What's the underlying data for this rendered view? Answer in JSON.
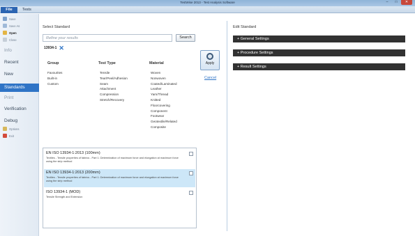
{
  "window": {
    "title": "TestWise 2013 - Test Analysis Software",
    "controls": [
      "–",
      "□",
      "✕"
    ]
  },
  "menu": {
    "file": "File",
    "tests": "Tests"
  },
  "sidebar": {
    "save": "Save",
    "save_as": "Save As",
    "open": "Open",
    "close": "Close",
    "info": "Info",
    "recent": "Recent",
    "new": "New",
    "standards": "Standards",
    "print": "Print",
    "verification": "Verification",
    "debug": "Debug",
    "options": "Options",
    "exit": "Exit"
  },
  "select_standard": {
    "title": "Select Standard",
    "search_placeholder": "Refine your results",
    "search_button": "Search",
    "filter_token": "13934-1",
    "columns": [
      {
        "header": "Group",
        "items": [
          "Favourites",
          "Built-in",
          "Custom"
        ]
      },
      {
        "header": "Test Type",
        "items": [
          "Tensile",
          "Tear/Peel/Adhesion",
          "Seam",
          "Attachment",
          "Compression",
          "Stretch/Recovery"
        ]
      },
      {
        "header": "Material",
        "items": [
          "Woven",
          "Nonwoven",
          "Coated/Laminated",
          "Leather",
          "Yarn/Thread",
          "Knitted",
          "Floorcovering",
          "Component",
          "Footwear",
          "Geotextile/Related",
          "Composite"
        ]
      }
    ],
    "apply_label": "Apply",
    "cancel_label": "Cancel",
    "results": [
      {
        "title": "EN ISO 13934-1:2013 (100mm)",
        "desc": "Textiles - Tensile properties of fabrics - Part 1: Determination of maximum force and elongation at maximum force using the strip method",
        "selected": false
      },
      {
        "title": "EN ISO 13934-1:2013 (200mm)",
        "desc": "Textiles - Tensile properties of fabrics - Part 1: Determination of maximum force and elongation at maximum force using the strip method",
        "selected": true
      },
      {
        "title": "ISO 13934-1 (MOD)",
        "desc": "Tensile Strength and Extension",
        "selected": false
      }
    ]
  },
  "edit_standard": {
    "title": "Edit Standard",
    "sections": [
      "+ General Settings",
      "+ Procedure Settings",
      "+ Result Settings"
    ]
  },
  "colors": {
    "accent": "#2f74c6",
    "selected_row": "#cde7f8",
    "settings_bar": "#323232"
  }
}
